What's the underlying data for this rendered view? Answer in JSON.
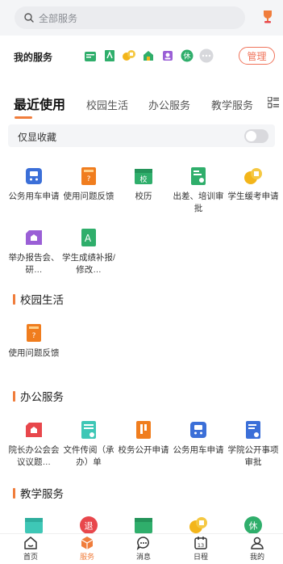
{
  "search": {
    "placeholder": "全部服务"
  },
  "my_services": {
    "title": "我的服务",
    "manage_label": "管理",
    "shortcut_badge": "休"
  },
  "tabs": [
    "最近使用",
    "校园生活",
    "办公服务",
    "教学服务"
  ],
  "favorites_filter": {
    "label": "仅显收藏",
    "enabled": false
  },
  "recent": [
    {
      "label": "公务用车申请",
      "icon": "car-icon",
      "color": "#3b6fd8"
    },
    {
      "label": "使用问题反馈",
      "icon": "feedback-icon",
      "color": "#f07d1e"
    },
    {
      "label": "校历",
      "icon": "calendar-icon",
      "color": "#2fae6b",
      "badge": "校"
    },
    {
      "label": "出差、培训审批",
      "icon": "id-card-icon",
      "color": "#2fae6b"
    },
    {
      "label": "学生缓考申请",
      "icon": "exam-icon",
      "color": "#f3b51a"
    },
    {
      "label": "举办报告会、研…",
      "icon": "report-icon",
      "color": "#9a5fd6"
    },
    {
      "label": "学生成绩补报/修改…",
      "icon": "grade-icon",
      "color": "#2fae6b",
      "badge": "A"
    }
  ],
  "sections": {
    "campus": {
      "title": "校园生活",
      "items": [
        {
          "label": "使用问题反馈",
          "icon": "feedback-icon",
          "color": "#f07d1e"
        }
      ]
    },
    "office": {
      "title": "办公服务",
      "items": [
        {
          "label": "院长办公会会议议题…",
          "icon": "meeting-icon",
          "color": "#e8474c"
        },
        {
          "label": "文件传阅（承办）单",
          "icon": "document-icon",
          "color": "#3ec7b6"
        },
        {
          "label": "校务公开申请",
          "icon": "notice-icon",
          "color": "#f07d1e"
        },
        {
          "label": "公务用车申请",
          "icon": "car-icon",
          "color": "#3b6fd8"
        },
        {
          "label": "学院公开事项审批",
          "icon": "approval-icon",
          "color": "#3b6fd8"
        }
      ]
    },
    "teaching": {
      "title": "教学服务",
      "peek_badges": [
        "退",
        "休"
      ]
    }
  },
  "bottom_nav": [
    {
      "label": "首页",
      "icon": "home-icon"
    },
    {
      "label": "服务",
      "icon": "service-cube-icon",
      "active": true
    },
    {
      "label": "消息",
      "icon": "message-icon"
    },
    {
      "label": "日程",
      "icon": "calendar-icon",
      "badge": "13"
    },
    {
      "label": "我的",
      "icon": "user-icon"
    }
  ]
}
